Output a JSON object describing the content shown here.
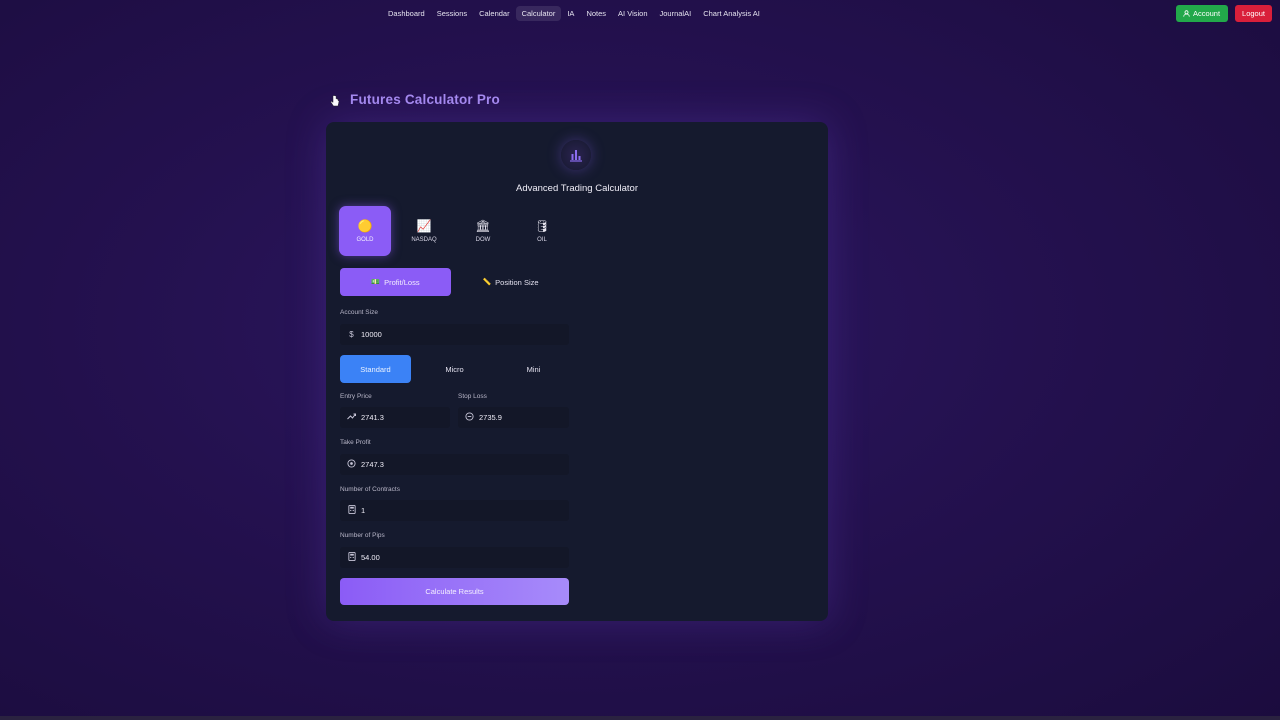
{
  "nav": {
    "links": [
      "Dashboard",
      "Sessions",
      "Calendar",
      "Calculator",
      "IA",
      "Notes",
      "AI Vision",
      "JournalAI",
      "Chart Analysis AI"
    ],
    "active": "Calculator",
    "account_label": "Account",
    "logout_label": "Logout"
  },
  "page": {
    "title": "Futures Calculator Pro"
  },
  "card": {
    "title": "Advanced Trading Calculator",
    "assets": [
      {
        "label": "GOLD",
        "icon": "gold-coin-icon",
        "glyph": "🟡",
        "active": true
      },
      {
        "label": "NASDAQ",
        "icon": "chart-up-icon",
        "glyph": "📈",
        "active": false
      },
      {
        "label": "DOW",
        "icon": "bank-icon",
        "glyph": "🏛",
        "active": false
      },
      {
        "label": "OIL",
        "icon": "oil-barrel-icon",
        "glyph": "🛢",
        "active": false
      }
    ],
    "modes": [
      {
        "label": "Profit/Loss",
        "icon": "money-icon",
        "glyph": "💵",
        "active": true
      },
      {
        "label": "Position Size",
        "icon": "ruler-icon",
        "glyph": "📏",
        "active": false
      }
    ],
    "account_size": {
      "label": "Account Size",
      "value": "10000",
      "icon": "dollar-icon"
    },
    "contract_sizes": [
      {
        "label": "Standard",
        "active": true
      },
      {
        "label": "Micro",
        "active": false
      },
      {
        "label": "Mini",
        "active": false
      }
    ],
    "entry_price": {
      "label": "Entry Price",
      "value": "2741.3",
      "icon": "trend-icon"
    },
    "stop_loss": {
      "label": "Stop Loss",
      "value": "2735.9",
      "icon": "stop-icon"
    },
    "take_profit": {
      "label": "Take Profit",
      "value": "2747.3",
      "icon": "target-icon"
    },
    "contracts": {
      "label": "Number of Contracts",
      "value": "1",
      "icon": "calculator-icon"
    },
    "pips": {
      "label": "Number of Pips",
      "value": "54.00",
      "icon": "calculator-icon"
    },
    "calculate_label": "Calculate Results"
  },
  "colors": {
    "accent_purple": "#8b5cf6",
    "accent_blue": "#3b82f6",
    "account_green": "#22a84a",
    "logout_red": "#d91f3a",
    "title_purple": "#a68bf0"
  }
}
